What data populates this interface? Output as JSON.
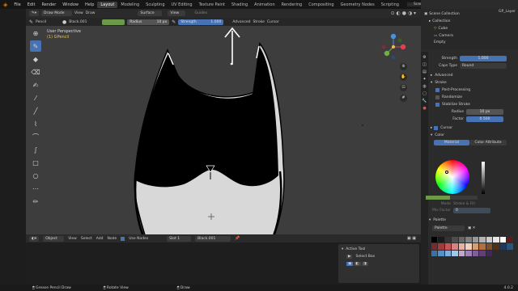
{
  "topbar": {
    "menus": [
      "File",
      "Edit",
      "Render",
      "Window",
      "Help"
    ],
    "workspaces": [
      "Layout",
      "Modeling",
      "Sculpting",
      "UV Editing",
      "Texture Paint",
      "Shading",
      "Animation",
      "Rendering",
      "Compositing",
      "Geometry Nodes",
      "Scripting"
    ],
    "active_workspace": "Layout",
    "scene": "Scene",
    "view_layer": "ViewLayer"
  },
  "header": {
    "mode": "Draw Mode",
    "menus": [
      "View",
      "Draw"
    ],
    "placement": "Surface",
    "view_menu": "View",
    "guides": "Guides"
  },
  "tool_settings": {
    "brush_type": "Pencil",
    "material": "Black.001",
    "radius_label": "Radius",
    "radius_value": "10 px",
    "strength_label": "Strength",
    "strength_value": "1.000",
    "advanced": "Advanced",
    "stroke": "Stroke",
    "cursor": "Cursor"
  },
  "viewport": {
    "perspective_label": "User Perspective",
    "object_label": "(1) GPencil",
    "bg_color": "#3d3d3d"
  },
  "outliner": {
    "title": "Scene Collection",
    "items": [
      "Collection",
      "Cube",
      "Camera",
      "Empty"
    ],
    "layer": "GP_Layer"
  },
  "properties": {
    "strength_label": "Strength",
    "strength_value": "1.000",
    "caps_label": "Caps Type",
    "caps_value": "Round",
    "advanced": "Advanced",
    "stroke": "Stroke",
    "post_processing": "Post-Processing",
    "randomize": "Randomize",
    "stabilize": "Stabilize Stroke",
    "radius_label": "Radius",
    "radius_value": "10 px",
    "factor_label": "Factor",
    "factor_value": "0.500",
    "cursor": "Cursor",
    "color": "Color",
    "material_tab": "Material",
    "color_attr_tab": "Color Attribute",
    "mode_label": "Mode",
    "mode_value": "Stroke & Fill",
    "mix_label": "Mix Factor",
    "mix_value": "0",
    "palette": "Palette",
    "palette_name": "Palette"
  },
  "timeline": {
    "object": "Object",
    "menus": [
      "View",
      "Select",
      "Add",
      "Node"
    ],
    "use_nodes": "Use Nodes",
    "slot": "Slot 1",
    "material": "Black.001",
    "active_tool": "Active Tool",
    "select_box": "Select Box"
  },
  "statusbar": {
    "items": [
      "Grease Pencil Draw",
      "Rotate View",
      "Draw"
    ],
    "version": "4.0.2"
  },
  "palette_colors": [
    "#000000",
    "#1a1a1a",
    "#333333",
    "#4d4d4d",
    "#666666",
    "#808080",
    "#999999",
    "#b3b3b3",
    "#cccccc",
    "#e6e6e6",
    "#ffffff",
    "#5a1d1d",
    "#7a2a2a",
    "#a33a3a",
    "#c65555",
    "#d98080",
    "#e8b0a0",
    "#f0d0c0",
    "#d4a070",
    "#b07040",
    "#80502a",
    "#503018",
    "#1d3a5a",
    "#2a557a",
    "#3a73a3",
    "#5590c6",
    "#80b0d9",
    "#a0c8e8",
    "#c0a8d0",
    "#a080b8",
    "#80609a",
    "#604078",
    "#402858"
  ]
}
